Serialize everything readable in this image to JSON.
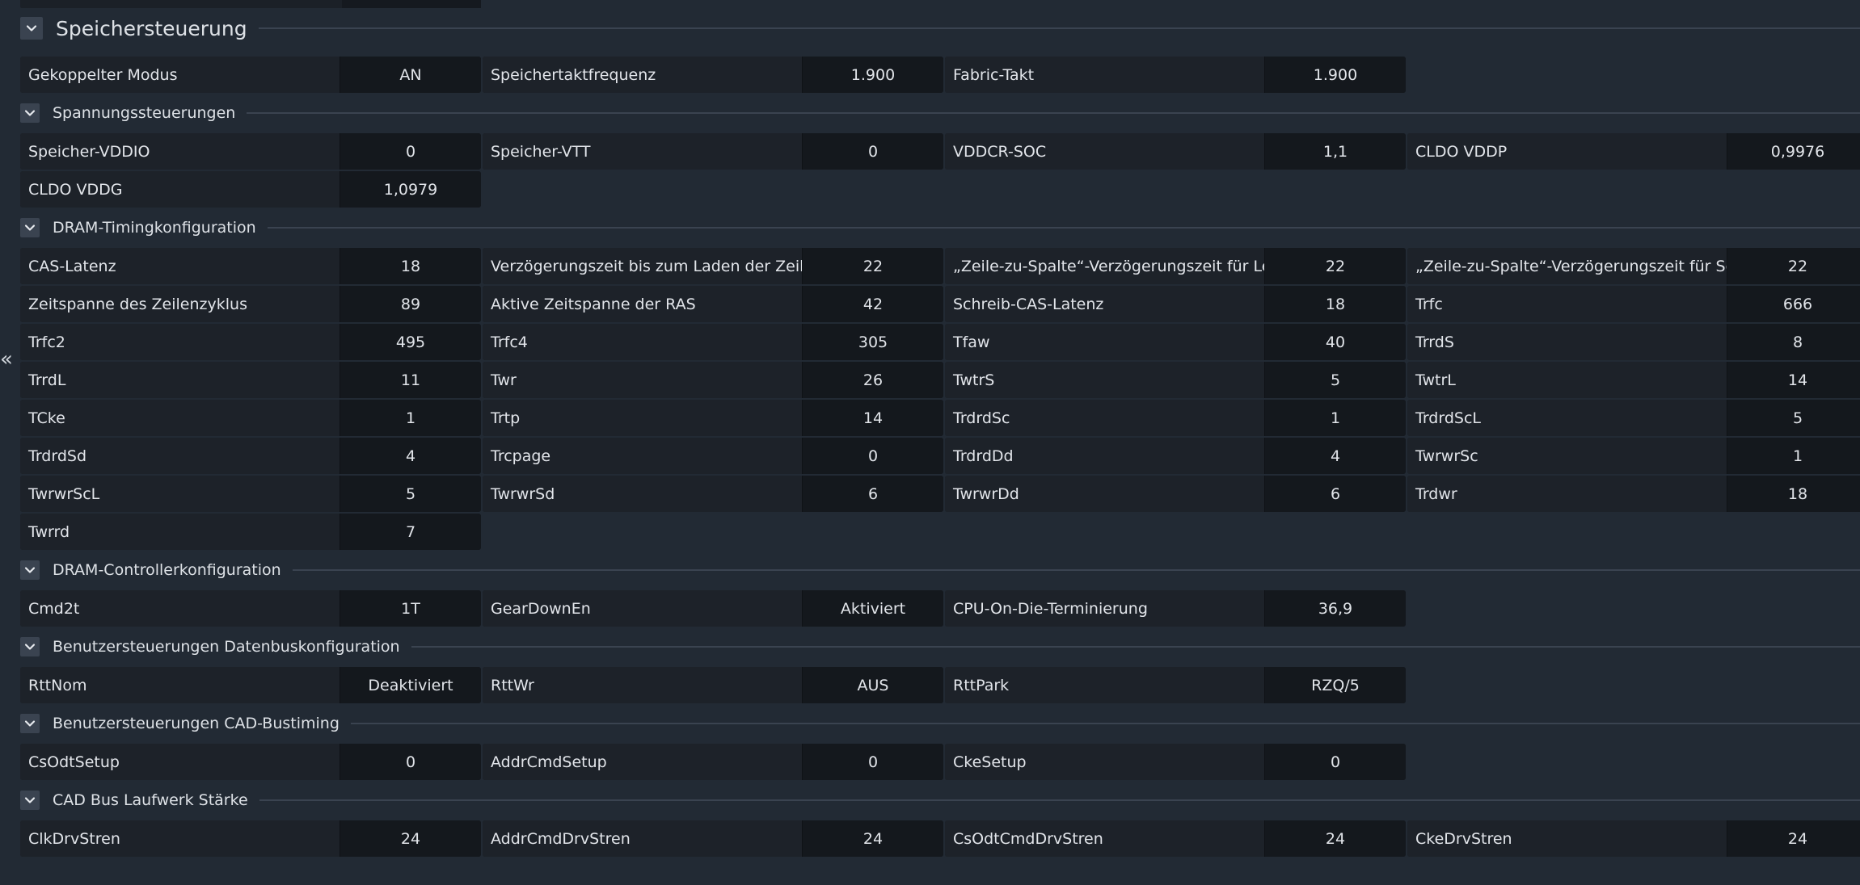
{
  "sections": [
    {
      "id": "speichersteuerung",
      "title": "Speichersteuerung",
      "big": true,
      "rows": [
        {
          "label": "Gekoppelter Modus",
          "value": "AN"
        },
        {
          "label": "Speichertaktfrequenz",
          "value": "1.900"
        },
        {
          "label": "Fabric-Takt",
          "value": "1.900"
        }
      ]
    },
    {
      "id": "spannungssteuerungen",
      "title": "Spannungssteuerungen",
      "rows": [
        {
          "label": "Speicher-VDDIO",
          "value": "0"
        },
        {
          "label": "Speicher-VTT",
          "value": "0"
        },
        {
          "label": "VDDCR-SOC",
          "value": "1,1"
        },
        {
          "label": "CLDO VDDP",
          "value": "0,9976"
        },
        {
          "label": "CLDO VDDG",
          "value": "1,0979"
        }
      ]
    },
    {
      "id": "dram-timing",
      "title": "DRAM-Timingkonfiguration",
      "rows": [
        {
          "label": "CAS-Latenz",
          "value": "18"
        },
        {
          "label": "Verzögerungszeit bis zum Laden der Zeile",
          "value": "22"
        },
        {
          "label": "„Zeile-zu-Spalte“-Verzögerungszeit für Les...",
          "value": "22"
        },
        {
          "label": "„Zeile-zu-Spalte“-Verzögerungszeit für Schr...",
          "value": "22"
        },
        {
          "label": "Zeitspanne des Zeilenzyklus",
          "value": "89"
        },
        {
          "label": "Aktive Zeitspanne der RAS",
          "value": "42"
        },
        {
          "label": "Schreib-CAS-Latenz",
          "value": "18"
        },
        {
          "label": "Trfc",
          "value": "666"
        },
        {
          "label": "Trfc2",
          "value": "495"
        },
        {
          "label": "Trfc4",
          "value": "305"
        },
        {
          "label": "Tfaw",
          "value": "40"
        },
        {
          "label": "TrrdS",
          "value": "8"
        },
        {
          "label": "TrrdL",
          "value": "11"
        },
        {
          "label": "Twr",
          "value": "26"
        },
        {
          "label": "TwtrS",
          "value": "5"
        },
        {
          "label": "TwtrL",
          "value": "14"
        },
        {
          "label": "TCke",
          "value": "1"
        },
        {
          "label": "Trtp",
          "value": "14"
        },
        {
          "label": "TrdrdSc",
          "value": "1"
        },
        {
          "label": "TrdrdScL",
          "value": "5"
        },
        {
          "label": "TrdrdSd",
          "value": "4"
        },
        {
          "label": "Trcpage",
          "value": "0"
        },
        {
          "label": "TrdrdDd",
          "value": "4"
        },
        {
          "label": "TwrwrSc",
          "value": "1"
        },
        {
          "label": "TwrwrScL",
          "value": "5"
        },
        {
          "label": "TwrwrSd",
          "value": "6"
        },
        {
          "label": "TwrwrDd",
          "value": "6"
        },
        {
          "label": "Trdwr",
          "value": "18"
        },
        {
          "label": "Twrrd",
          "value": "7"
        }
      ]
    },
    {
      "id": "dram-controller",
      "title": "DRAM-Controllerkonfiguration",
      "rows": [
        {
          "label": "Cmd2t",
          "value": "1T"
        },
        {
          "label": "GearDownEn",
          "value": "Aktiviert"
        },
        {
          "label": "CPU-On-Die-Terminierung",
          "value": "36,9"
        }
      ]
    },
    {
      "id": "datenbus",
      "title": "Benutzersteuerungen Datenbuskonfiguration",
      "rows": [
        {
          "label": "RttNom",
          "value": "Deaktiviert"
        },
        {
          "label": "RttWr",
          "value": "AUS"
        },
        {
          "label": "RttPark",
          "value": "RZQ/5"
        }
      ]
    },
    {
      "id": "cad-bustiming",
      "title": "Benutzersteuerungen CAD-Bustiming",
      "rows": [
        {
          "label": "CsOdtSetup",
          "value": "0"
        },
        {
          "label": "AddrCmdSetup",
          "value": "0"
        },
        {
          "label": "CkeSetup",
          "value": "0"
        }
      ]
    },
    {
      "id": "cad-drive",
      "title": "CAD Bus Laufwerk Stärke",
      "rows": [
        {
          "label": "ClkDrvStren",
          "value": "24"
        },
        {
          "label": "AddrCmdDrvStren",
          "value": "24"
        },
        {
          "label": "CsOdtCmdDrvStren",
          "value": "24"
        },
        {
          "label": "CkeDrvStren",
          "value": "24"
        }
      ]
    }
  ]
}
